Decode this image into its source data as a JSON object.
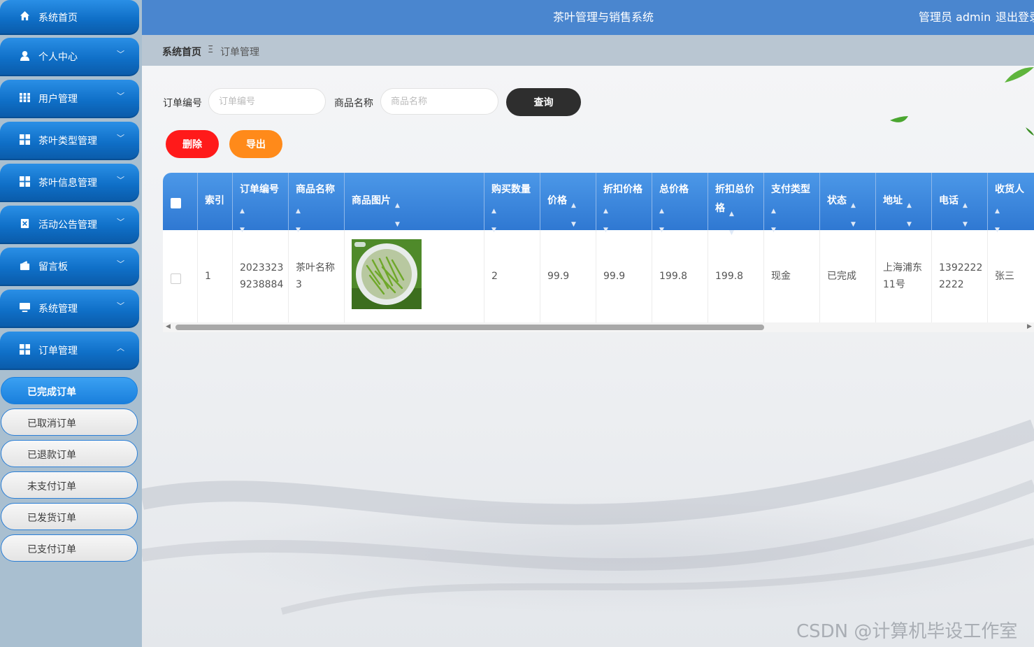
{
  "header": {
    "title": "茶叶管理与销售系统",
    "user": "管理员 admin",
    "logout": "退出登录"
  },
  "sidebar": {
    "items": [
      {
        "label": "系统首页",
        "icon": "home-icon"
      },
      {
        "label": "个人中心",
        "icon": "user-icon"
      },
      {
        "label": "用户管理",
        "icon": "grid-icon"
      },
      {
        "label": "茶叶类型管理",
        "icon": "grid-icon"
      },
      {
        "label": "茶叶信息管理",
        "icon": "grid-icon"
      },
      {
        "label": "活动公告管理",
        "icon": "document-icon"
      },
      {
        "label": "留言板",
        "icon": "wallet-icon"
      },
      {
        "label": "系统管理",
        "icon": "monitor-icon"
      },
      {
        "label": "订单管理",
        "icon": "grid-icon"
      }
    ],
    "sub_items": [
      "已完成订单",
      "已取消订单",
      "已退款订单",
      "未支付订单",
      "已发货订单",
      "已支付订单"
    ]
  },
  "breadcrumb": {
    "home": "系统首页",
    "separator": "Ξ",
    "current": "订单管理"
  },
  "search": {
    "order_no_label": "订单编号",
    "order_no_placeholder": "订单编号",
    "product_label": "商品名称",
    "product_placeholder": "商品名称",
    "query_button": "查询"
  },
  "actions": {
    "delete": "删除",
    "export": "导出"
  },
  "table": {
    "headers": {
      "index": "索引",
      "order_no": "订单编号",
      "product_name": "商品名称",
      "product_image": "商品图片",
      "quantity": "购买数量",
      "price": "价格",
      "discount_price_1": "折扣价格",
      "total_price": "总价格",
      "discount_total_1": "折扣总价",
      "discount_total_2": "格",
      "pay_type": "支付类型",
      "status": "状态",
      "address": "地址",
      "phone": "电话",
      "receiver": "收货人"
    },
    "row": {
      "index": "1",
      "order_no_1": "2023323",
      "order_no_2": "9238884",
      "product_name_1": "茶叶名称",
      "product_name_2": "3",
      "quantity": "2",
      "price": "99.9",
      "discount_price": "99.9",
      "total_price": "199.8",
      "discount_total": "199.8",
      "pay_type": "现金",
      "status": "已完成",
      "address_1": "上海浦东",
      "address_2": "11号",
      "phone_1": "1392222",
      "phone_2": "2222",
      "receiver": "张三"
    }
  },
  "watermark": "CSDN @计算机毕设工作室",
  "colors": {
    "header": "#4a86cf",
    "accent": "#1a7fdc",
    "delete": "#ff1a1a",
    "export": "#ff8a1a",
    "query": "#2e2e2e"
  }
}
